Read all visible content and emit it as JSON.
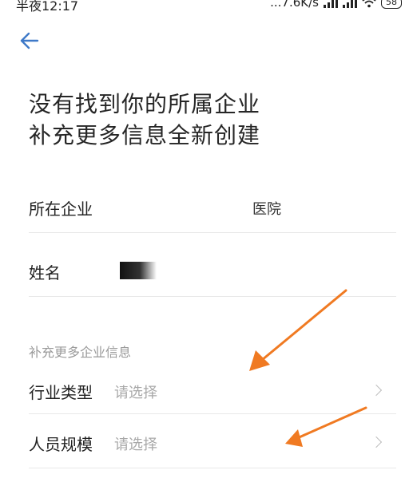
{
  "status_bar": {
    "time": "半夜12:17",
    "network_speed": "...7.6K/s",
    "battery": "58"
  },
  "header": {
    "back_icon": "arrow-left-icon"
  },
  "title": {
    "line1": "没有找到你的所属企业",
    "line2": "补充更多信息全新创建"
  },
  "form": {
    "company": {
      "label": "所在企业",
      "value": "医院"
    },
    "name": {
      "label": "姓名",
      "value": ""
    },
    "section_label": "补充更多企业信息",
    "industry": {
      "label": "行业类型",
      "placeholder": "请选择"
    },
    "scale": {
      "label": "人员规模",
      "placeholder": "请选择"
    }
  },
  "colors": {
    "accent": "#3e79c8",
    "annotation_arrow": "#f07a22"
  }
}
